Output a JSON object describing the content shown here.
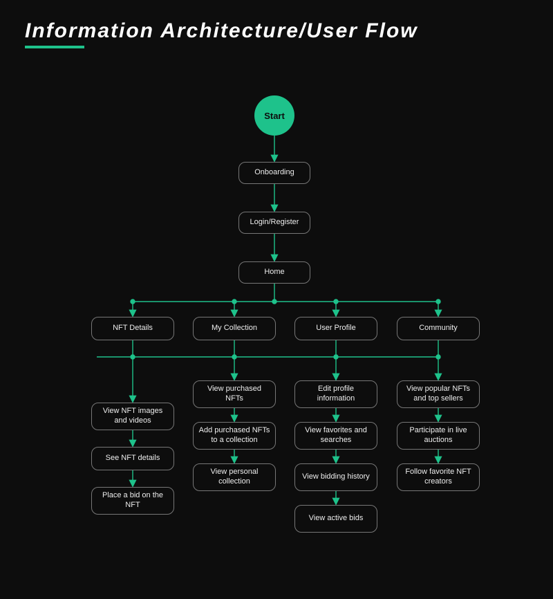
{
  "title": "Information Architecture/User Flow",
  "colors": {
    "accent": "#1ec28b",
    "bg": "#0d0d0d",
    "border": "#777"
  },
  "nodes": {
    "start": "Start",
    "onboarding": "Onboarding",
    "login": "Login/Register",
    "home": "Home",
    "nft_details": "NFT Details",
    "my_collection": "My Collection",
    "user_profile": "User Profile",
    "community": "Community",
    "nft_1": "View NFT images and videos",
    "nft_2": "See NFT details",
    "nft_3": "Place a bid on the NFT",
    "col_1": "View purchased NFTs",
    "col_2": "Add purchased NFTs to a collection",
    "col_3": "View personal collection",
    "prof_1": "Edit profile information",
    "prof_2": "View  favorites and searches",
    "prof_3": "View bidding history",
    "prof_4": "View active bids",
    "com_1": "View popular NFTs and top sellers",
    "com_2": "Participate in live auctions",
    "com_3": "Follow favorite NFT creators"
  }
}
